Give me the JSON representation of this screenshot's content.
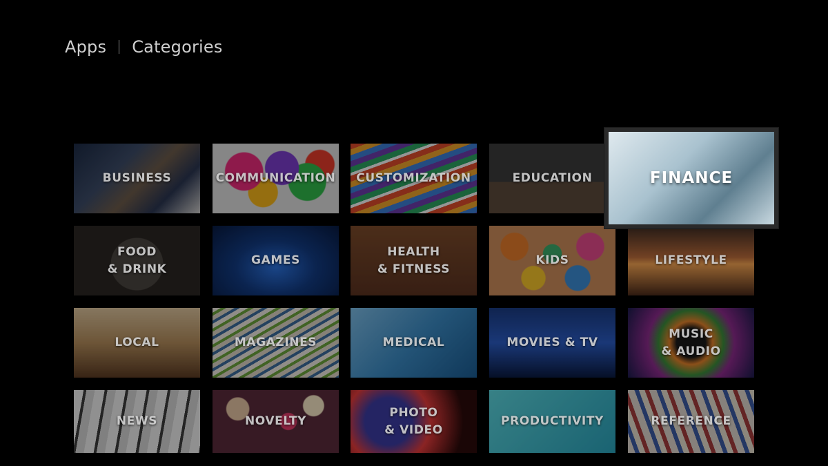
{
  "breadcrumb": {
    "root": "Apps",
    "current": "Categories"
  },
  "focused_category": "FINANCE",
  "categories": [
    {
      "label": "BUSINESS"
    },
    {
      "label": "COMMUNICATION"
    },
    {
      "label": "CUSTOMIZATION"
    },
    {
      "label": "EDUCATION"
    },
    {
      "label": "FINANCE"
    },
    {
      "label": "FOOD\n& DRINK"
    },
    {
      "label": "GAMES"
    },
    {
      "label": "HEALTH\n& FITNESS"
    },
    {
      "label": "KIDS"
    },
    {
      "label": "LIFESTYLE"
    },
    {
      "label": "LOCAL"
    },
    {
      "label": "MAGAZINES"
    },
    {
      "label": "MEDICAL"
    },
    {
      "label": "MOVIES & TV"
    },
    {
      "label": "MUSIC\n& AUDIO"
    },
    {
      "label": "NEWS"
    },
    {
      "label": "NOVELTY"
    },
    {
      "label": "PHOTO\n& VIDEO"
    },
    {
      "label": "PRODUCTIVITY"
    },
    {
      "label": "REFERENCE"
    }
  ]
}
